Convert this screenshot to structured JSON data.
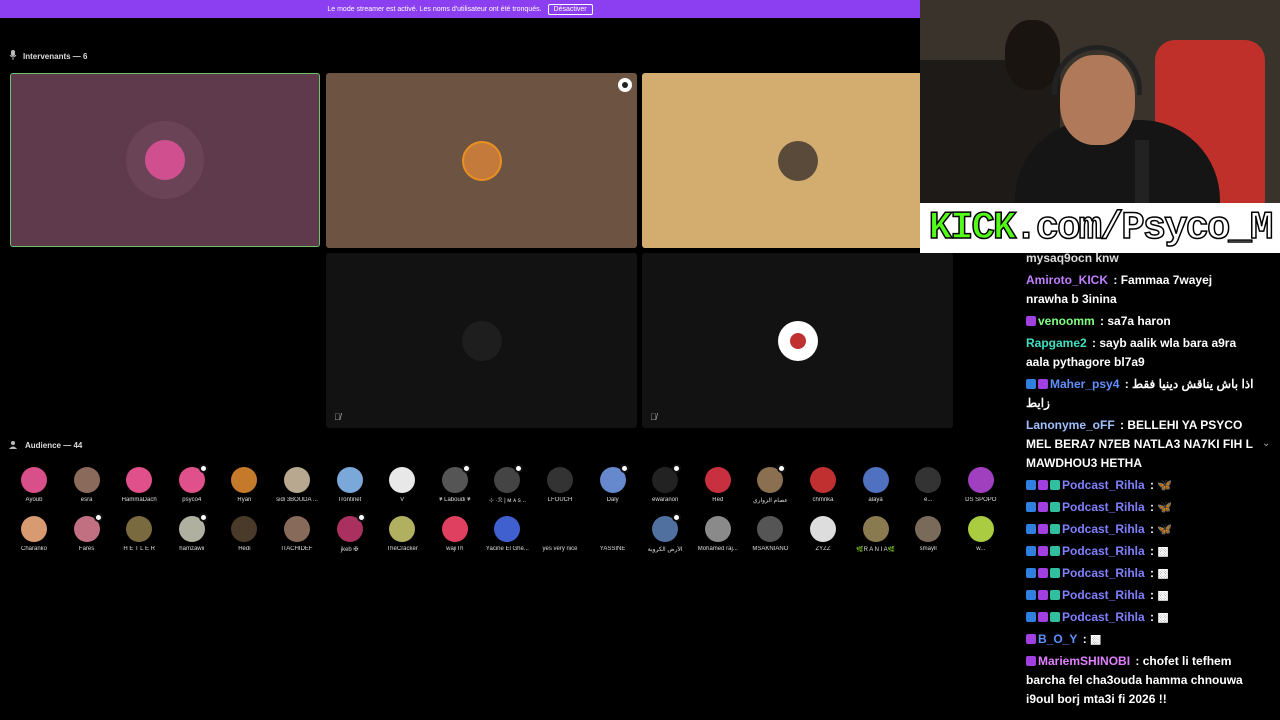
{
  "banner": {
    "text": "Le mode streamer est activé. Les noms d'utilisateur ont été tronqués.",
    "button": "Désactiver"
  },
  "speakers": {
    "header": "Intervenants — 6"
  },
  "audience": {
    "header": "Audience — 44",
    "row1": [
      {
        "name": "Ayoub",
        "color": "#d94f8a",
        "badge": false
      },
      {
        "name": "esra",
        "color": "#8a6a5a",
        "badge": false
      },
      {
        "name": "HammaDach",
        "color": "#e0508a",
        "badge": false
      },
      {
        "name": "psyco4",
        "color": "#e0508a",
        "badge": true
      },
      {
        "name": "Ryan",
        "color": "#c47a2a",
        "badge": false
      },
      {
        "name": "sidi 3BOUDA ...",
        "color": "#b8a890",
        "badge": false
      },
      {
        "name": "Trontinet",
        "color": "#7aa8d8",
        "badge": false
      },
      {
        "name": "V",
        "color": "#e8e8e8",
        "badge": false
      },
      {
        "name": "¥ Laboudi ¥",
        "color": "#555",
        "badge": true
      },
      {
        "name": "⊹ ·ℛ | ᴍ ᴀ ꜱ ..",
        "color": "#444",
        "badge": true
      },
      {
        "name": "LFOUCH",
        "color": "#333",
        "badge": false
      },
      {
        "name": "Daly",
        "color": "#6688cc",
        "badge": true
      },
      {
        "name": "ewaranon",
        "color": "#222",
        "badge": true
      },
      {
        "name": "Red",
        "color": "#c83040",
        "badge": false
      },
      {
        "name": "عصام الزواري",
        "color": "#8a7050",
        "badge": true
      },
      {
        "name": "chmnka",
        "color": "#c03030",
        "badge": false
      },
      {
        "name": "alaya",
        "color": "#5070c0",
        "badge": false
      },
      {
        "name": "e...",
        "color": "#333",
        "badge": false
      },
      {
        "name": "DS SPOPO",
        "color": "#a040c0",
        "badge": false
      }
    ],
    "row2": [
      {
        "name": "Charanko",
        "color": "#d89a70",
        "badge": false
      },
      {
        "name": "Fares",
        "color": "#c07080",
        "badge": true
      },
      {
        "name": "H E T L E R",
        "color": "#7a6a40",
        "badge": false
      },
      {
        "name": "hamzawii",
        "color": "#b0b0a0",
        "badge": true
      },
      {
        "name": "Hedi",
        "color": "#4a3a2a",
        "badge": false
      },
      {
        "name": "ITACHIDEF",
        "color": "#886a5a",
        "badge": false
      },
      {
        "name": "jkeb ✠",
        "color": "#aa3060",
        "badge": true
      },
      {
        "name": "TheCracker",
        "color": "#b0b060",
        "badge": false
      },
      {
        "name": "wajiTh",
        "color": "#e04060",
        "badge": false
      },
      {
        "name": "Yacine El Ghe...",
        "color": "#4060d0",
        "badge": false
      },
      {
        "name": "yes very nice",
        "color": "#000",
        "badge": false
      },
      {
        "name": "YASSINE",
        "color": "#000",
        "badge": false
      },
      {
        "name": "الأرض الكروية",
        "color": "#5070a0",
        "badge": true
      },
      {
        "name": "Mohamed raj...",
        "color": "#8a8a8a",
        "badge": false
      },
      {
        "name": "MSAKNIANO",
        "color": "#555",
        "badge": false
      },
      {
        "name": "ZYZZ",
        "color": "#ddd",
        "badge": false
      },
      {
        "name": "🌿R A N I A🌿",
        "color": "#8a7a50",
        "badge": false
      },
      {
        "name": "smayll",
        "color": "#7a6a5a",
        "badge": false
      },
      {
        "name": "w...",
        "color": "#aacc40",
        "badge": false
      }
    ]
  },
  "overlay": {
    "kick_prefix": "KICK",
    "kick_suffix": ".com/Psyco_M"
  },
  "chat": {
    "top_fragment": "mysaq9ocn knw",
    "messages": [
      {
        "user": "Amiroto_KICK",
        "color": "#c080ff",
        "text": "Fammaa 7wayej nrawha b 3inina",
        "icons": []
      },
      {
        "user": "venoomm",
        "color": "#80ff80",
        "text": "sa7a haron",
        "icons": [
          "#a040e0"
        ]
      },
      {
        "user": "Rapgame2",
        "color": "#40e0c0",
        "text": "sayb aalik wla bara a9ra aala pythagore bl7a9",
        "icons": []
      },
      {
        "user": "Maher_psy4",
        "color": "#6090ff",
        "text": "اذا باش يناقش دينيا فقط زايط",
        "icons": [
          "#3080e0",
          "#a040e0"
        ]
      },
      {
        "user": "Lanonyme_oFF",
        "color": "#a0c0ff",
        "text": "BELLEHI YA PSYCO MEL BERA7 N7EB NATLA3 NA7KI FIH L MAWDHOU3 HETHA",
        "icons": []
      },
      {
        "user": "Podcast_Rihla",
        "color": "#8080ff",
        "text": "🦋",
        "icons": [
          "#3080e0",
          "#a040e0",
          "#30c0a0"
        ]
      },
      {
        "user": "Podcast_Rihla",
        "color": "#8080ff",
        "text": "🦋",
        "icons": [
          "#3080e0",
          "#a040e0",
          "#30c0a0"
        ]
      },
      {
        "user": "Podcast_Rihla",
        "color": "#8080ff",
        "text": "🦋",
        "icons": [
          "#3080e0",
          "#a040e0",
          "#30c0a0"
        ]
      },
      {
        "user": "Podcast_Rihla",
        "color": "#8080ff",
        "text": "▩",
        "icons": [
          "#3080e0",
          "#a040e0",
          "#30c0a0"
        ]
      },
      {
        "user": "Podcast_Rihla",
        "color": "#8080ff",
        "text": "▩",
        "icons": [
          "#3080e0",
          "#a040e0",
          "#30c0a0"
        ]
      },
      {
        "user": "Podcast_Rihla",
        "color": "#8080ff",
        "text": "▩",
        "icons": [
          "#3080e0",
          "#a040e0",
          "#30c0a0"
        ]
      },
      {
        "user": "Podcast_Rihla",
        "color": "#8080ff",
        "text": "▩",
        "icons": [
          "#3080e0",
          "#a040e0",
          "#30c0a0"
        ]
      },
      {
        "user": "B_O_Y",
        "color": "#6090ff",
        "text": "▩",
        "icons": [
          "#a040e0"
        ]
      },
      {
        "user": "MariemSHINOBI",
        "color": "#e080ff",
        "text": "chofet li tefhem barcha fel cha3ouda hamma chnouwa i9oul borj mta3i fi 2026 !!",
        "icons": [
          "#a040e0"
        ]
      }
    ]
  }
}
